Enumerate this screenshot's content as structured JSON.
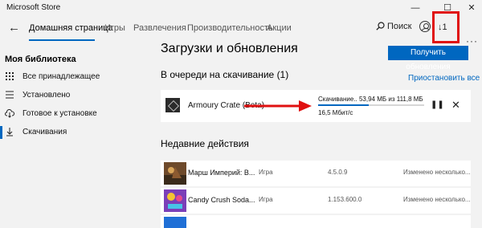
{
  "window": {
    "title": "Microsoft Store",
    "minimize_icon": "minimize-icon",
    "maximize_icon": "maximize-icon",
    "close_icon": "close-icon"
  },
  "nav": {
    "back_icon": "back-arrow-icon",
    "tabs": [
      {
        "label": "Домашняя страница",
        "active": true
      },
      {
        "label": "Игры",
        "active": false
      },
      {
        "label": "Развлечения",
        "active": false
      },
      {
        "label": "Производительность",
        "active": false
      },
      {
        "label": "Акции",
        "active": false
      }
    ],
    "search_label": "Поиск",
    "downloads_count": "1",
    "more_label": "···"
  },
  "library": {
    "title": "Моя библиотека",
    "items": [
      {
        "label": "Все принадлежащее",
        "icon": "grid-icon",
        "selected": false
      },
      {
        "label": "Установлено",
        "icon": "installed-list-icon",
        "selected": false
      },
      {
        "label": "Готовое к установке",
        "icon": "cloud-download-icon",
        "selected": false
      },
      {
        "label": "Скачивания",
        "icon": "download-icon",
        "selected": true
      }
    ]
  },
  "main": {
    "title": "Загрузки и обновления",
    "get_updates_label": "Получить обновления",
    "queue_title": "В очереди на скачивание (1)",
    "pause_all_label": "Приостановить все",
    "queue": [
      {
        "name": "Armoury Crate (Beta)",
        "status": "Скачивание.. 53,94 МБ из 111,8 МБ",
        "speed": "16,5 Мбит/с",
        "progress": 0.48
      }
    ],
    "recent_title": "Недавние действия",
    "recent": [
      {
        "name": "Марш Империй: В...",
        "type": "Игра",
        "version": "4.5.0.9",
        "status": "Изменено несколько..."
      },
      {
        "name": "Candy Crush Soda...",
        "type": "Игра",
        "version": "1.153.600.0",
        "status": "Изменено несколько..."
      },
      {
        "name": "",
        "type": "",
        "version": "",
        "status": ""
      }
    ]
  },
  "colors": {
    "accent": "#0067c0",
    "highlight": "#e01010",
    "background": "#f2f2f2",
    "card": "#ffffff"
  }
}
